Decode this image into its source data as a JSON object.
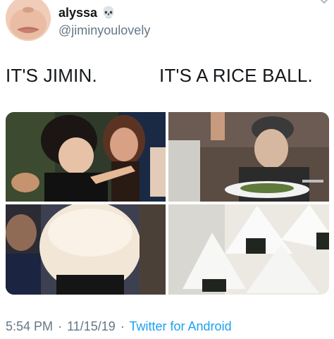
{
  "user": {
    "display_name": "alyssa",
    "name_emoji": "💀",
    "handle": "@jiminyoulovely"
  },
  "caption": {
    "left": "IT'S JIMIN.",
    "right": "IT'S A RICE BALL."
  },
  "footer": {
    "time": "5:54 PM",
    "separator": "·",
    "date": "11/15/19",
    "client": "Twitter for Android"
  },
  "colors": {
    "secondary_text": "#657786",
    "link": "#1da1f2"
  },
  "icons": [
    "chevron-down-icon",
    "skull-icon"
  ]
}
